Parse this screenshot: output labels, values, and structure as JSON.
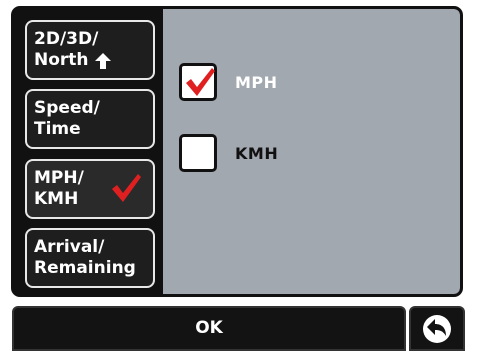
{
  "sidebar": {
    "items": [
      {
        "line1": "2D/3D/",
        "line2": "North",
        "icon": "arrow-up-icon"
      },
      {
        "line1": "Speed/",
        "line2": "Time"
      },
      {
        "line1": "MPH/",
        "line2": "KMH",
        "icon": "checkmark-icon",
        "selected": true
      },
      {
        "line1": "Arrival/",
        "line2": "Remaining"
      }
    ]
  },
  "options": [
    {
      "label": "MPH",
      "checked": true
    },
    {
      "label": "KMH",
      "checked": false
    }
  ],
  "footer": {
    "ok_label": "OK",
    "back_icon": "back-arrow-icon"
  },
  "colors": {
    "content_bg": "#a2a8b0",
    "check_red": "#e02020",
    "frame": "#111111"
  }
}
